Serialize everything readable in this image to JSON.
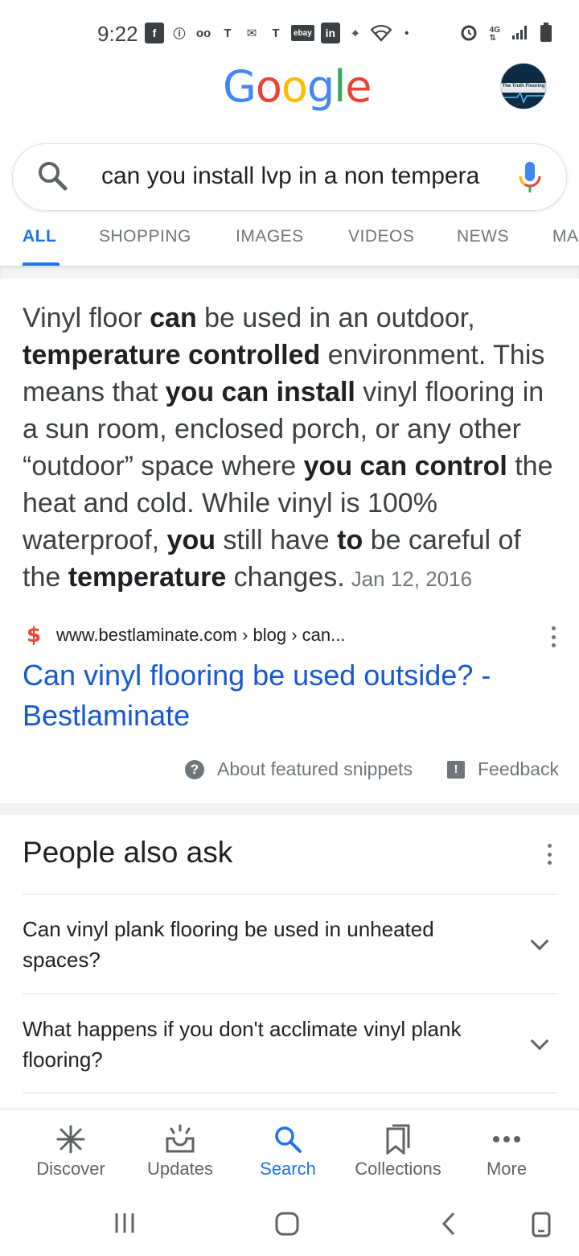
{
  "status_bar": {
    "time": "9:22",
    "left_icons": [
      "facebook-icon",
      "info-icon",
      "voicemail-icon",
      "tmobile-icon",
      "gmail-icon",
      "tmobile-icon",
      "ebay-icon",
      "linkedin-icon",
      "maps-icon",
      "wifi-icon",
      "dot-icon"
    ],
    "ebay_label": "ebay",
    "linkedin_label": "in",
    "right_icons": [
      "alarm-icon",
      "lte-icon",
      "signal-icon",
      "battery-icon"
    ]
  },
  "header": {
    "logo": [
      "G",
      "o",
      "o",
      "g",
      "l",
      "e"
    ],
    "logo_colors": [
      "#4285F4",
      "#EA4335",
      "#FBBC05",
      "#4285F4",
      "#34A853",
      "#EA4335"
    ],
    "avatar_text": "The Truth Flooring"
  },
  "search": {
    "query": "can you install lvp in a non tempera"
  },
  "tabs": {
    "items": [
      {
        "label": "ALL",
        "active": true
      },
      {
        "label": "SHOPPING",
        "active": false
      },
      {
        "label": "IMAGES",
        "active": false
      },
      {
        "label": "VIDEOS",
        "active": false
      },
      {
        "label": "NEWS",
        "active": false
      },
      {
        "label": "MA",
        "active": false
      }
    ]
  },
  "snippet": {
    "segments": [
      {
        "text": "Vinyl floor ",
        "bold": false
      },
      {
        "text": "can",
        "bold": true
      },
      {
        "text": " be used in an outdoor, ",
        "bold": false
      },
      {
        "text": "temperature controlled",
        "bold": true
      },
      {
        "text": " environment. This means that ",
        "bold": false
      },
      {
        "text": "you can install",
        "bold": true
      },
      {
        "text": " vinyl flooring in a sun room, enclosed porch, or any other “outdoor” space where ",
        "bold": false
      },
      {
        "text": "you can control",
        "bold": true
      },
      {
        "text": " the heat and cold. While vinyl is 100% waterproof, ",
        "bold": false
      },
      {
        "text": "you",
        "bold": true
      },
      {
        "text": " still have ",
        "bold": false
      },
      {
        "text": "to",
        "bold": true
      },
      {
        "text": " be careful of the ",
        "bold": false
      },
      {
        "text": "temperature",
        "bold": true
      },
      {
        "text": " changes.",
        "bold": false
      }
    ],
    "date": "Jan 12, 2016",
    "favicon": "$",
    "source_url": "www.bestlaminate.com › blog › can...",
    "result_title": "Can vinyl flooring be used outside? - Bestlaminate",
    "about_label": "About featured snippets",
    "feedback_label": "Feedback"
  },
  "people_also_ask": {
    "title": "People also ask",
    "questions": [
      "Can vinyl plank flooring be used in unheated spaces?",
      "What happens if you don't acclimate vinyl plank flooring?"
    ]
  },
  "bottom_nav": {
    "items": [
      {
        "label": "Discover",
        "icon": "asterisk-icon",
        "active": false
      },
      {
        "label": "Updates",
        "icon": "updates-inbox-icon",
        "active": false
      },
      {
        "label": "Search",
        "icon": "search-icon",
        "active": true
      },
      {
        "label": "Collections",
        "icon": "bookmark-icon",
        "active": false
      },
      {
        "label": "More",
        "icon": "more-dots-icon",
        "active": false
      }
    ]
  },
  "colors": {
    "accent": "#1a73e8",
    "link": "#1558d6",
    "muted": "#70757a"
  }
}
